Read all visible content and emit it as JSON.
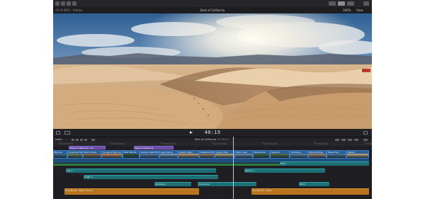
{
  "window": {
    "library_label": "All (9,999) · Hidden",
    "project_title": "Best of California",
    "zoom": "100%",
    "view_menu": "View"
  },
  "transport": {
    "timecode": "40:19"
  },
  "timeline": {
    "index_label": "Index",
    "project_name": "Best of California",
    "duration": "07:09:27",
    "ruler_marks": [
      "00:00:00:00",
      "00:00:10:00",
      "00:00:20:00",
      "00:00:30:00",
      "00:00:40:00",
      "00:00:50:00",
      "00:01:00:00"
    ],
    "connected_titles": [
      {
        "label": "Best of California - Int"
      },
      {
        "label": "Best of California"
      }
    ],
    "storyline_clips": [
      {
        "label": "Big Sur"
      },
      {
        "label": "Yosemite Falls"
      },
      {
        "label": "Point Arena"
      },
      {
        "label": "Sunset at Big Sur"
      },
      {
        "label": "Muir Woods"
      },
      {
        "label": "Golden Gate Bridge"
      },
      {
        "label": "Lake Tahoe"
      },
      {
        "label": "Death Valley"
      },
      {
        "label": "Alabama Hills"
      },
      {
        "label": "Joshua Tree"
      },
      {
        "label": "Mono Lake"
      },
      {
        "label": "Redwoods"
      },
      {
        "label": "Sequoia"
      },
      {
        "label": "Monterey"
      },
      {
        "label": "Bixby Bridge"
      },
      {
        "label": "Mavericks"
      },
      {
        "label": "Malibu"
      }
    ],
    "audio_teal": [
      {
        "label": "City 1"
      },
      {
        "label": "Traffic 1"
      },
      {
        "label": "Nature 1"
      },
      {
        "label": "Ambience"
      },
      {
        "label": "Voice Over"
      },
      {
        "label": "Birds"
      },
      {
        "label": "Wind"
      }
    ],
    "audio_orange": [
      {
        "label": "Soundtrack - Main Theme"
      },
      {
        "label": "Soundtrack - Outro"
      }
    ]
  },
  "icons": {
    "play": "play-icon",
    "settings": "gear-icon"
  },
  "colors": {
    "storyline": "#2a5f99",
    "title_clip": "#6a4aa8",
    "audio_teal": "#1d6f75",
    "music": "#b7741c"
  }
}
